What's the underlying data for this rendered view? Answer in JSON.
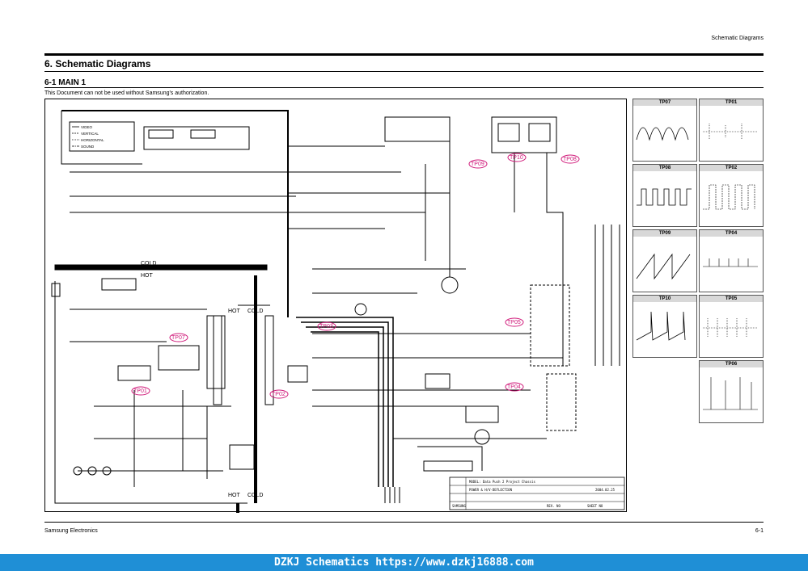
{
  "header": {
    "right_text": "Schematic Diagrams"
  },
  "section_title": "6. Schematic Diagrams",
  "sub_title": "6-1 MAIN 1",
  "notice": "This Document can not be used without Samsung's authorization.",
  "schematic": {
    "labels": {
      "cold": "COLD",
      "hot": "HOT",
      "hot_cold_1": "HOT",
      "cold_1": "COLD",
      "hot_cold_2": "HOT",
      "cold_2": "COLD"
    },
    "legend": [
      "VIDEO",
      "VERTICAL",
      "HORIZONTAL",
      "SOUND"
    ],
    "test_points": [
      "TP09",
      "TP10",
      "TP08",
      "TP07",
      "TP03",
      "TP05",
      "TP01",
      "TP02",
      "TP04",
      "TP06"
    ],
    "title_block": {
      "title": "MODEL: Data Push 2 Project Chassis",
      "block": "POWER & H/V-DEFLECTION",
      "date": "2004.02.25",
      "company": "SAMSUNG",
      "rev": "REV. NO",
      "sheet": "SHEET NO"
    }
  },
  "waveforms": [
    {
      "left": "TP07",
      "right": "TP01"
    },
    {
      "left": "TP08",
      "right": "TP02"
    },
    {
      "left": "TP09",
      "right": "TP04"
    },
    {
      "left": "TP10",
      "right": "TP05"
    },
    {
      "left": "",
      "right": "TP06"
    }
  ],
  "footer": {
    "left": "Samsung Electronics",
    "right": "6-1"
  },
  "watermark": "DZKJ Schematics https://www.dzkj16888.com"
}
